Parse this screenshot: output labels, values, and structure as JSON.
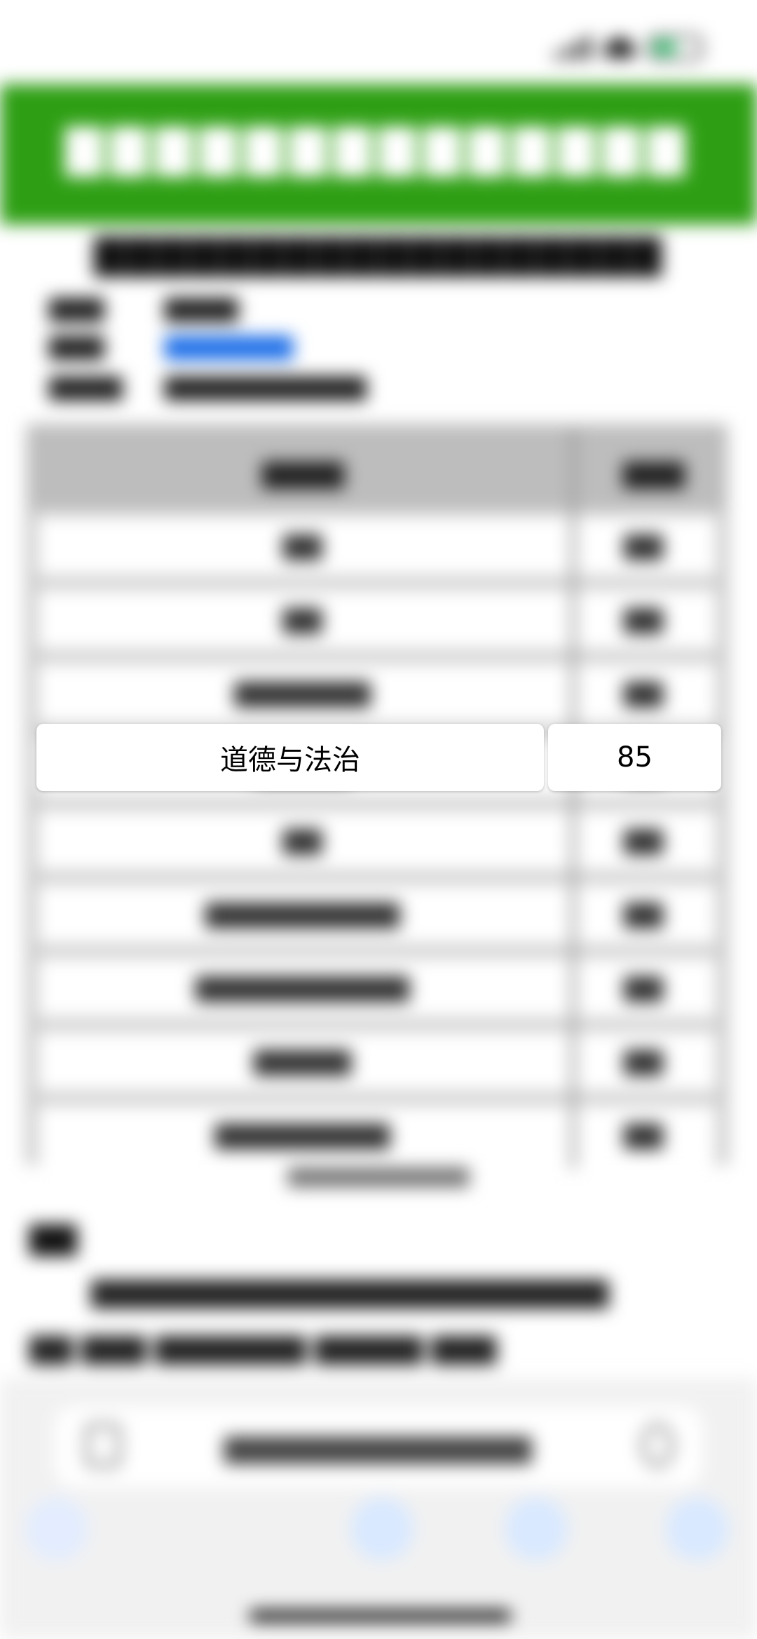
{
  "focused_row": {
    "subject": "道德与法治",
    "score": "85"
  },
  "colors": {
    "header_green": "#2e9f14",
    "link_blue": "#1e6fe8",
    "table_border": "#b7b7b7"
  },
  "icons": {
    "signal": "cellular-signal-icon",
    "wifi": "wifi-icon",
    "battery": "battery-icon",
    "tabs": "tabs-icon",
    "reload": "reload-icon",
    "back": "back-icon",
    "forward": "forward-icon",
    "share": "share-icon",
    "bookmarks": "bookmarks-icon",
    "tab-switcher": "tab-switcher-icon"
  }
}
